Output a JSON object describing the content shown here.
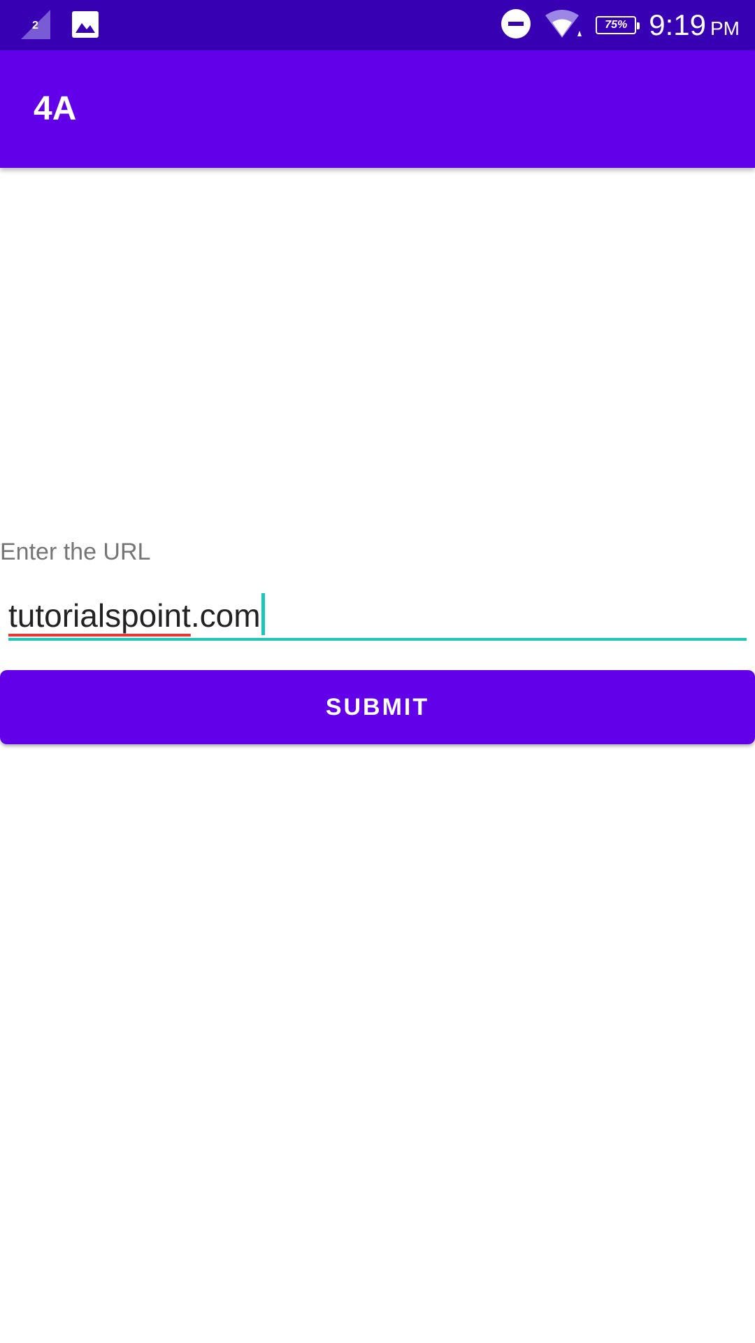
{
  "status_bar": {
    "sim_indicator": "2",
    "battery_percent": "75%",
    "time": "9:19",
    "ampm": "PM",
    "icons": [
      "signal-icon",
      "image-icon",
      "do-not-disturb-icon",
      "wifi-icon",
      "battery-icon"
    ],
    "background": "#3700b3"
  },
  "app_bar": {
    "title": "4A",
    "background": "#6200ea"
  },
  "form": {
    "label": "Enter the URL",
    "input_value_misspelled": "tutorialspoint",
    "input_value_suffix": ".com",
    "accent_color": "#1ec6b8",
    "submit_label": "SUBMIT"
  }
}
